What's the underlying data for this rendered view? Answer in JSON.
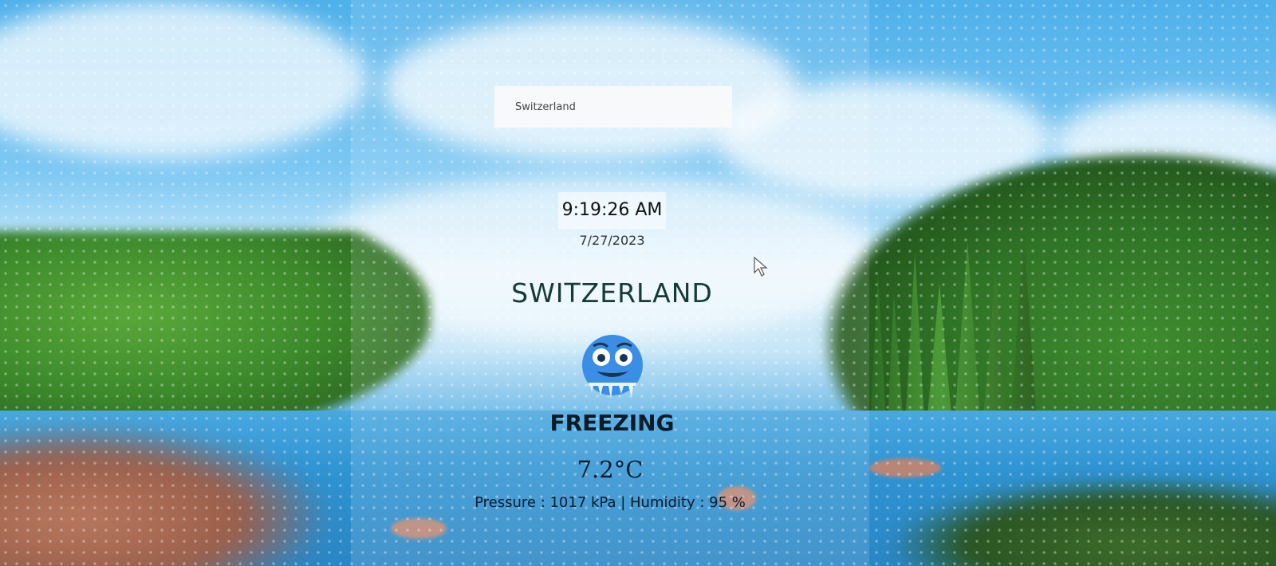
{
  "search": {
    "value": "Switzerland"
  },
  "clock": {
    "time": "9:19:26 AM",
    "date": "7/27/2023"
  },
  "location": {
    "city": "SWITZERLAND"
  },
  "weather": {
    "icon": "freezing-face-icon",
    "condition": "FREEZING",
    "temperature": "7.2°C",
    "details": "Pressure : 1017 kPa | Humidity : 95 %"
  },
  "colors": {
    "sky": "#4fb0ea",
    "lake": "#2f93d2",
    "text": "#0b1b2a",
    "icon": "#3a8ee6"
  }
}
